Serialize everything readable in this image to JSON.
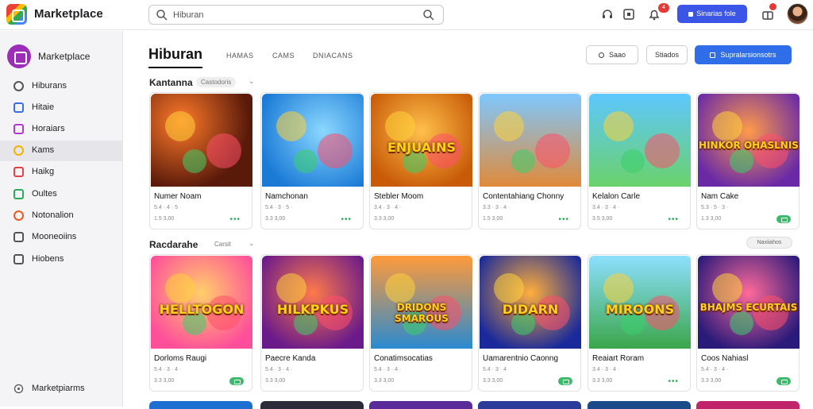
{
  "app": {
    "title": "Marketplace"
  },
  "search": {
    "value": "Hiburan",
    "placeholder": "Hiburan"
  },
  "topbar": {
    "notification_count": "4",
    "upgrade_label": "Sinarias fole"
  },
  "sidebar": {
    "brand": "Marketplace",
    "items": [
      {
        "label": "Hiburans",
        "icon": "grid-icon",
        "color": "#555555"
      },
      {
        "label": "Hitaie",
        "icon": "puzzle-icon",
        "color": "#3b6fe0"
      },
      {
        "label": "Horaiars",
        "icon": "book-icon",
        "color": "#b03ad0"
      },
      {
        "label": "Kams",
        "icon": "coin-icon",
        "color": "#f0b400",
        "active": true
      },
      {
        "label": "Haikg",
        "icon": "ticket-icon",
        "color": "#e0444b"
      },
      {
        "label": "Oultes",
        "icon": "leaf-icon",
        "color": "#2eaa5b"
      },
      {
        "label": "Notonalion",
        "icon": "fire-icon",
        "color": "#ee5a24"
      },
      {
        "label": "Mooneoiins",
        "icon": "search-icon",
        "color": "#555555"
      },
      {
        "label": "Hiobens",
        "icon": "document-icon",
        "color": "#555555"
      }
    ],
    "footer": "Marketpiarms"
  },
  "main": {
    "tabs": [
      {
        "label": "Hiburan",
        "active": true
      },
      {
        "label": "HAMAS"
      },
      {
        "label": "CAMS"
      },
      {
        "label": "DNIACANS"
      }
    ],
    "buttons": {
      "filter": "Saao",
      "sort": "Stiados",
      "primary": "Supralarsionsotrs"
    },
    "sections": [
      {
        "title": "Kantanna",
        "chip": "Castodoris",
        "cards": [
          {
            "title": "Numer Noam",
            "meta": "5.4 · 4 · 5 ·",
            "count": "1.5 3,00",
            "badge": "dots"
          },
          {
            "title": "Namchonan",
            "meta": "5.4 · 3 · 5 ·",
            "count": "3.3 3,00",
            "badge": "dots"
          },
          {
            "title": "Stebler Moom",
            "meta": "3.4 · 3 · 4 ·",
            "count": "3.3 3,00",
            "badge": "none"
          },
          {
            "title": "Contentahiang Chonny",
            "meta": "3.3 · 3 · 4 ·",
            "count": "1.5 3,00",
            "badge": "dots"
          },
          {
            "title": "Kelalon Carle",
            "meta": "3.4 · 3 · 4 ·",
            "count": "3.5 3,00",
            "badge": "dots"
          },
          {
            "title": "Nam Cake",
            "meta": "5.3 · 5 · 3 ·",
            "count": "1.3 3,00",
            "badge": "pill"
          }
        ]
      },
      {
        "title": "Racdarahe",
        "chip": "Carsit",
        "scroll_label": "Naxiiahos",
        "cards": [
          {
            "title": "Dorloms Raugi",
            "meta": "5.4 · 3 · 4 ·",
            "count": "3.3 3,00",
            "badge": "pill"
          },
          {
            "title": "Paecre Kanda",
            "meta": "5.4 · 3 · 4 ·",
            "count": "3.3 3,00",
            "badge": "none"
          },
          {
            "title": "Conatimsocatias",
            "meta": "5.4 · 3 · 4 ·",
            "count": "3.3 3,00",
            "badge": "none"
          },
          {
            "title": "Uamarentnio Caonng",
            "meta": "5.4 · 3 · 4 ·",
            "count": "3.3 3,00",
            "badge": "pill"
          },
          {
            "title": "Reaiart Roram",
            "meta": "3.4 · 3 · 4 ·",
            "count": "3.3 3,00",
            "badge": "dots"
          },
          {
            "title": "Coos Nahiasl",
            "meta": "5.4 · 3 · 4 ·",
            "count": "3.3 3,00",
            "badge": "pill"
          }
        ]
      }
    ],
    "thumb_words": [
      "",
      "",
      "ENJUAINS",
      "",
      "",
      "HINKOR OHASLNIS",
      "HELLTOGON",
      "HILKPKUS",
      "DRIDONS SMAROUS",
      "DIDARN",
      "MIROONS",
      "BHAJMS ECURTAIS"
    ],
    "dots_glyph": "•••"
  },
  "colors": {
    "accent": "#3b55e6",
    "primary_button": "#2f6ee8",
    "active_sidebar": "#e6e6ea"
  }
}
